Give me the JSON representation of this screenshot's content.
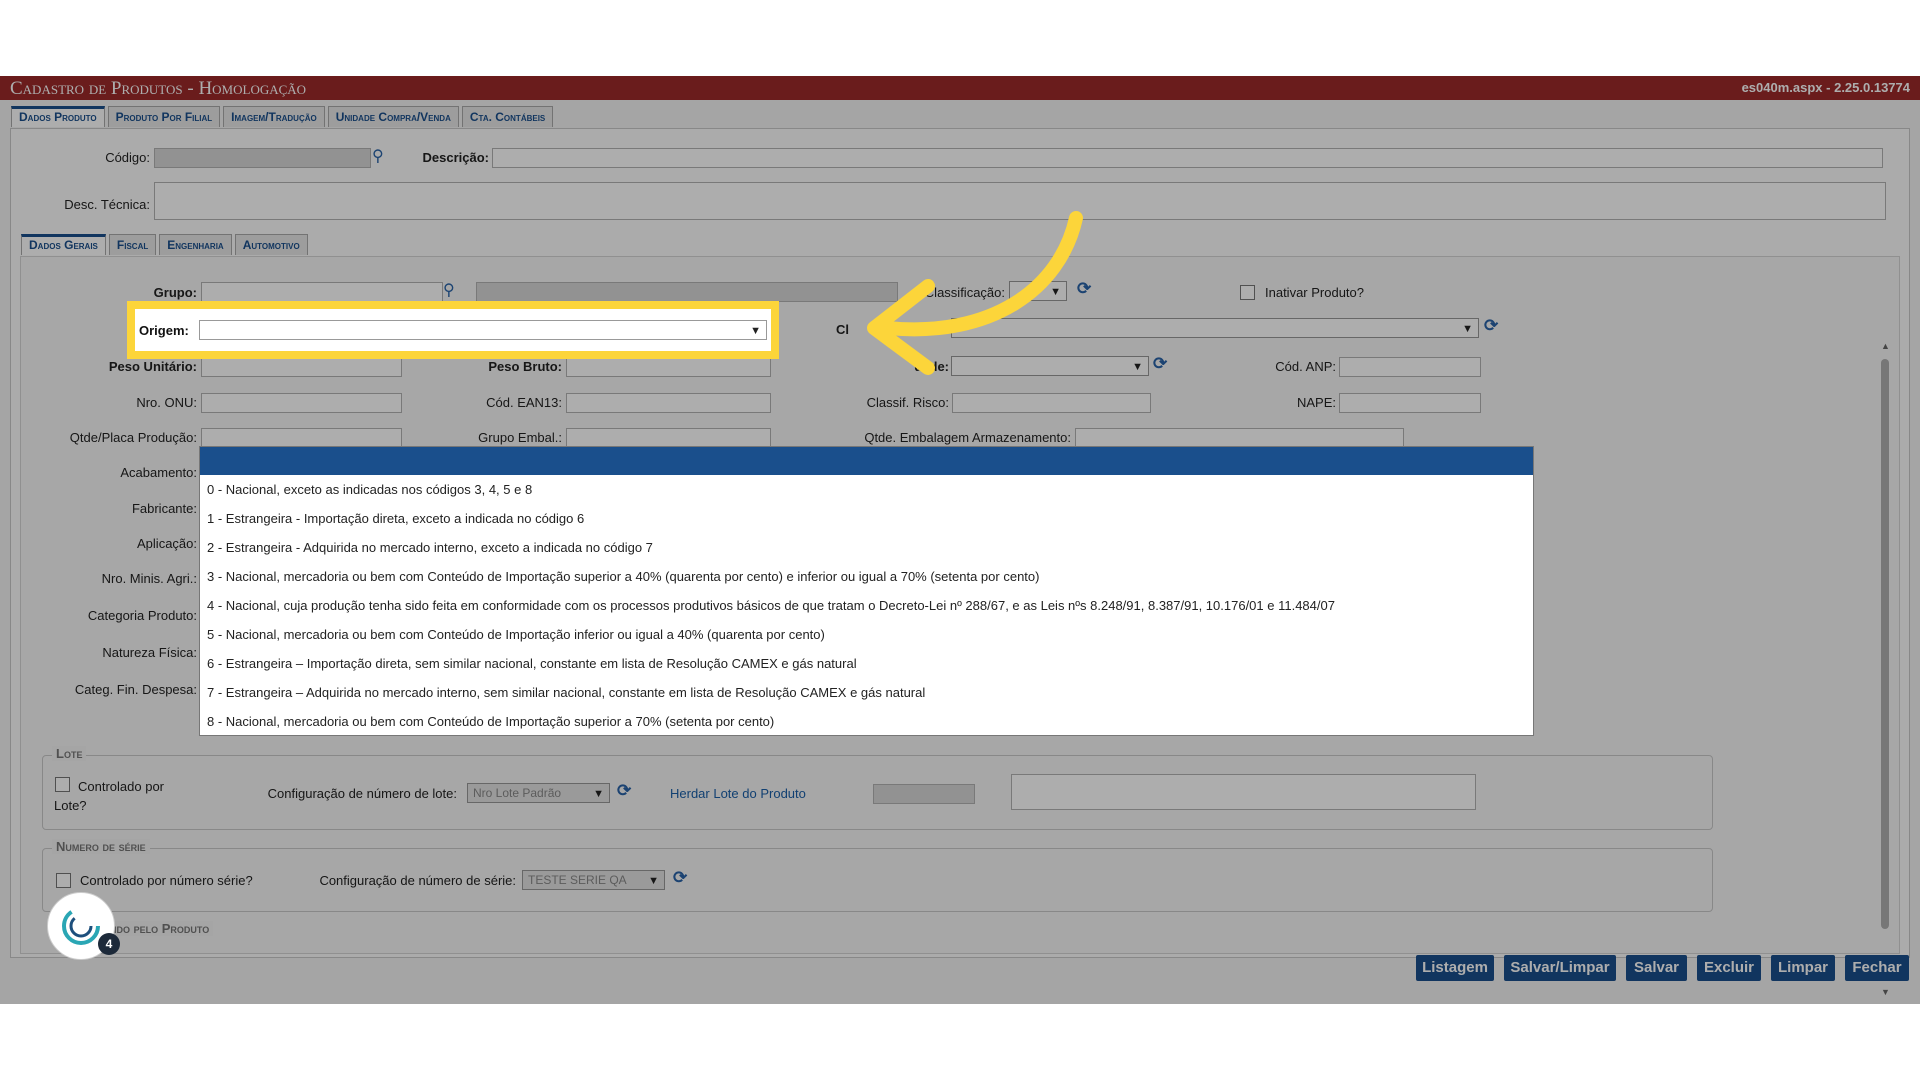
{
  "window": {
    "title": "Cadastro de Produtos  - Homologação",
    "version": "es040m.aspx - 2.25.0.13774"
  },
  "top_tabs": [
    "Dados Produto",
    "Produto Por Filial",
    "Imagem/Tradução",
    "Unidade Compra/Venda",
    "Cta. Contábeis"
  ],
  "header_fields": {
    "codigo_label": "Código:",
    "descricao_label": "Descrição:",
    "desc_tecnica_label": "Desc. Técnica:"
  },
  "sub_tabs": [
    "Dados Gerais",
    "Fiscal",
    "Engenharia",
    "Automotivo"
  ],
  "form": {
    "grupo_label": "Grupo:",
    "classificacao_label": "Classificação:",
    "inativar_label": "Inativar Produto?",
    "origem_label": "Origem:",
    "cl_label": "Cl",
    "peso_unitario_label": "Peso Unitário:",
    "peso_bruto_label": "Peso Bruto:",
    "unidade_label": "dade:",
    "cod_anp_label": "Cód. ANP:",
    "nro_onu_label": "Nro. ONU:",
    "cod_ean13_label": "Cód. EAN13:",
    "classif_risco_label": "Classif. Risco:",
    "nape_label": "NAPE:",
    "qtde_placa_label": "Qtde/Placa Produção:",
    "grupo_embal_label": "Grupo Embal.:",
    "qtde_embalagem_label": "Qtde. Embalagem Armazenamento:",
    "acabamento_label": "Acabamento:",
    "fabricante_label": "Fabricante:",
    "aplicacao_label": "Aplicação:",
    "nro_minis_label": "Nro. Minis. Agri.:",
    "categoria_label": "Categoria Produto:",
    "natureza_label": "Natureza Física:",
    "categ_fin_label": "Categ. Fin. Despesa:"
  },
  "origem_options": [
    "0 - Nacional, exceto as indicadas nos códigos 3, 4, 5 e 8",
    "1 - Estrangeira - Importação direta, exceto a indicada no código 6",
    "2 - Estrangeira - Adquirida no mercado interno, exceto a indicada no código 7",
    "3 - Nacional, mercadoria ou bem com Conteúdo de Importação superior a 40% (quarenta por cento) e inferior ou igual a 70% (setenta por cento)",
    "4 - Nacional, cuja produção tenha sido feita em conformidade com os processos produtivos básicos de que tratam o Decreto-Lei nº 288/67, e as Leis nºs 8.248/91, 8.387/91, 10.176/01 e 11.484/07",
    "5 - Nacional, mercadoria ou bem com Conteúdo de Importação inferior ou igual a 40% (quarenta por cento)",
    "6 - Estrangeira – Importação direta, sem similar nacional, constante em lista de Resolução CAMEX e gás natural",
    "7 - Estrangeira – Adquirida no mercado interno, sem similar nacional, constante em lista de Resolução CAMEX e gás natural",
    "8 - Nacional, mercadoria ou bem com Conteúdo de Importação superior a 70% (setenta por cento)"
  ],
  "lote": {
    "legend": "Lote",
    "controlado_label": "Controlado por Lote?",
    "config_label": "Configuração de número de lote:",
    "config_value": "Nro Lote Padrão",
    "herdar_link": "Herdar Lote do Produto"
  },
  "serie": {
    "legend": "Numero de série",
    "controlado_label": "Controlado por número série?",
    "config_label": "Configuração de número de série:",
    "config_value": "TESTE SERIE QA"
  },
  "partial_legend": "ido pelo Produto",
  "badge_count": "4",
  "buttons": [
    "Listagem",
    "Salvar/Limpar",
    "Salvar",
    "Excluir",
    "Limpar",
    "Fechar"
  ],
  "colors": {
    "title_bar": "#9c2a2a",
    "accent": "#1a4f8c",
    "callout": "#fcd53a"
  }
}
